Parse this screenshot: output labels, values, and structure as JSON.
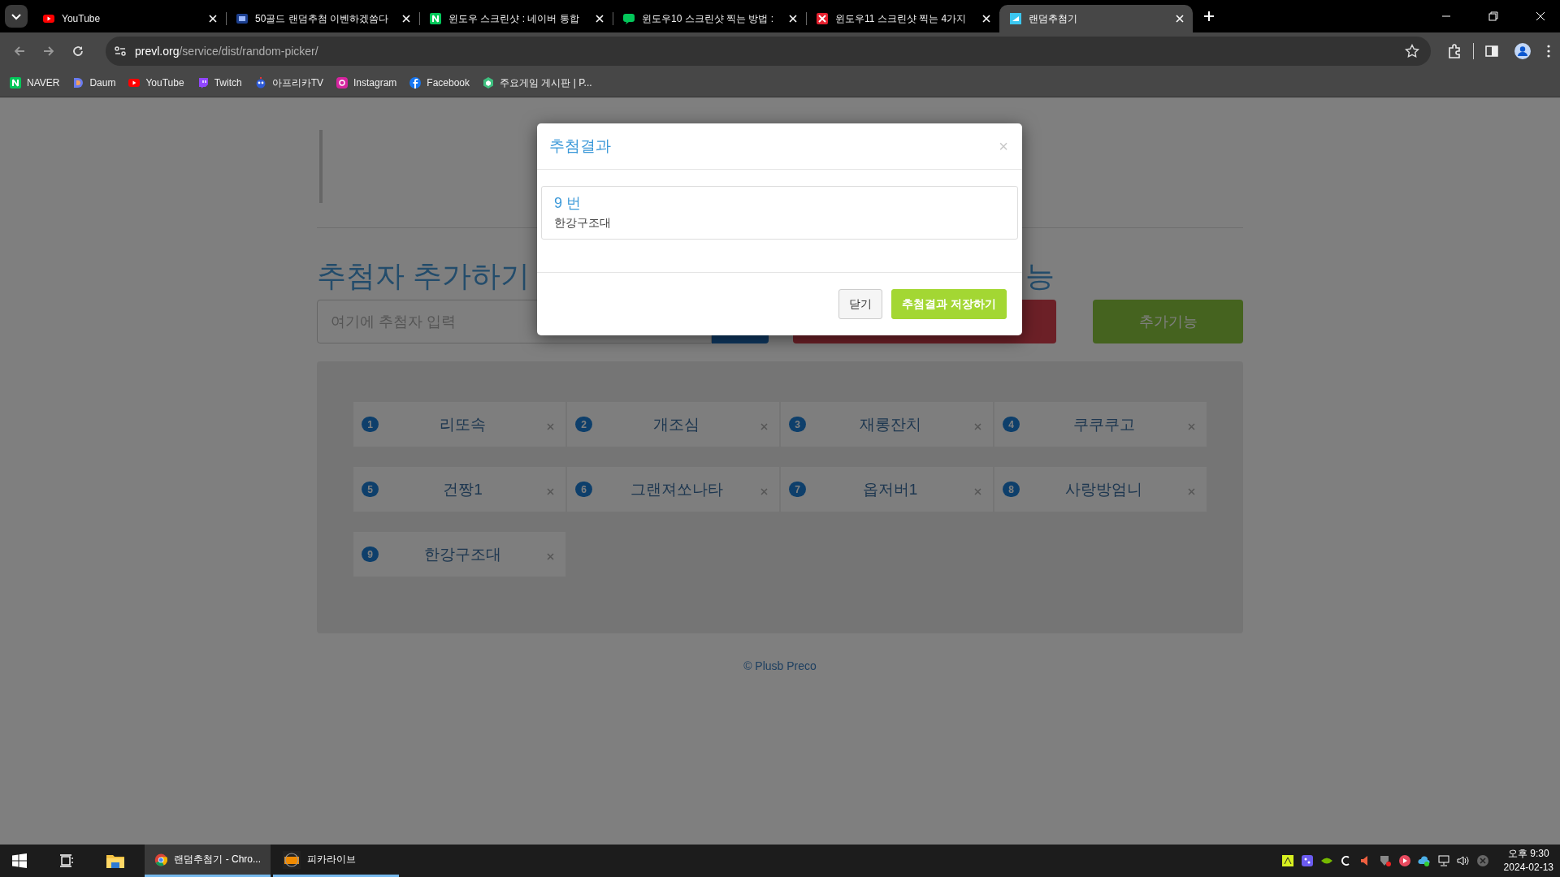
{
  "tabs": [
    {
      "title": "YouTube",
      "selected": false
    },
    {
      "title": "50골드 랜덤추첨 이벤하겠씀다",
      "selected": false
    },
    {
      "title": "윈도우 스크린샷 : 네이버 통합",
      "selected": false
    },
    {
      "title": "윈도우10 스크린샷 찍는 방법 :",
      "selected": false
    },
    {
      "title": "윈도우11 스크린샷 찍는 4가지",
      "selected": false
    },
    {
      "title": "랜덤추첨기",
      "selected": true
    }
  ],
  "address_bar": {
    "host": "prevl.org",
    "path": "/service/dist/random-picker/"
  },
  "bookmarks": [
    "NAVER",
    "Daum",
    "YouTube",
    "Twitch",
    "아프리카TV",
    "Instagram",
    "Facebook",
    "주요게임 게시판 | P..."
  ],
  "page": {
    "heading": "추첨자 추가하기",
    "heading_2": "능",
    "input": {
      "placeholder": "여기에 추첨자 입력"
    },
    "extra_button": "추가기능",
    "entries": [
      {
        "number": "1",
        "name": "리또속"
      },
      {
        "number": "2",
        "name": "개조심"
      },
      {
        "number": "3",
        "name": "재롱잔치"
      },
      {
        "number": "4",
        "name": "쿠쿠쿠고"
      },
      {
        "number": "5",
        "name": "건짱1"
      },
      {
        "number": "6",
        "name": "그랜져쏘나타"
      },
      {
        "number": "7",
        "name": "옵저버1"
      },
      {
        "number": "8",
        "name": "사랑방엄니"
      },
      {
        "number": "9",
        "name": "한강구조대"
      }
    ],
    "footer": "© Plusb Preco"
  },
  "modal": {
    "title": "추첨결과",
    "close": "×",
    "result_number": "9 번",
    "result_name": "한강구조대",
    "buttons": [
      "닫기",
      "추첨결과 저장하기"
    ]
  },
  "taskbar": {
    "apps": [
      {
        "label": "랜덤추첨기 - Chro...",
        "selected": true
      },
      {
        "label": "피카라이브",
        "selected": false
      }
    ],
    "time": "오후 9:30",
    "date": "2024-02-13"
  }
}
